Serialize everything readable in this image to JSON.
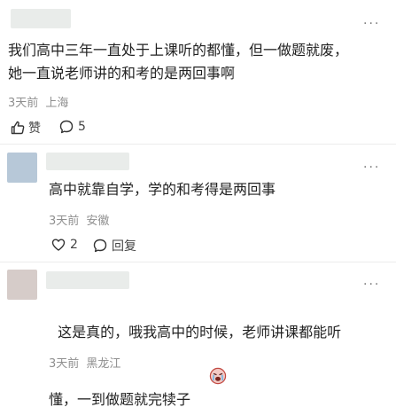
{
  "colors": {
    "reply1_avatar": "#b7c8d8",
    "reply2_avatar": "#d6ccc9",
    "name_placeholder": "#e9ecea",
    "meta_text": "#8f8f8f",
    "divider": "#ececec"
  },
  "top_comment": {
    "more_label": "···",
    "text": "我们高中三年一直处于上课听的都懂，但一做题就废，\n她一直说老师讲的和考的是两回事啊",
    "time": "3天前",
    "location": "上海",
    "like_icon": "thumbs-up-icon",
    "like_label": "赞",
    "reply_icon": "comment-bubble-icon",
    "reply_count": "5"
  },
  "replies": [
    {
      "more_label": "···",
      "text": "高中就靠自学，学的和考得是两回事",
      "time": "3天前",
      "location": "安徽",
      "like_icon": "heart-icon",
      "like_count": "2",
      "reply_icon": "comment-bubble-icon",
      "reply_label": "回复"
    },
    {
      "more_label": "···",
      "text": "这是真的，哦我高中的时候，老师讲课都能听\n懂，一到做题就完犊子",
      "emoji_icon": "crying-face-emoji-icon",
      "time": "3天前",
      "location": "黑龙江"
    }
  ]
}
